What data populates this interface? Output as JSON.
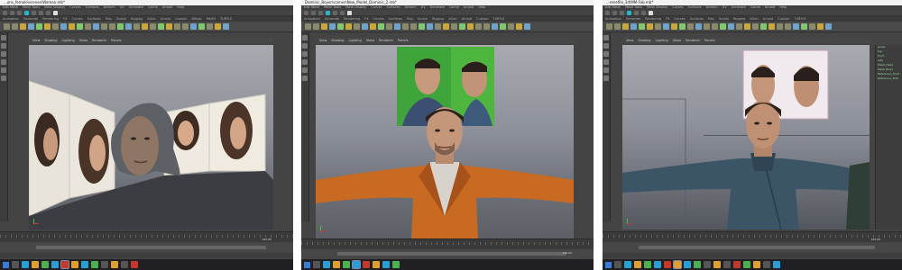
{
  "panels": [
    {
      "id": "p1",
      "title": "...ons_female\\scenes\\Woman.mb*",
      "menus": [
        "Edit Mesh",
        "Mesh Tools",
        "Mesh Display",
        "Curves",
        "Surfaces",
        "Deform",
        "UV",
        "Generate",
        "Cache",
        "Arnold",
        "Help"
      ],
      "shelf_tabs": [
        "Animation",
        "Generate",
        "Rendering",
        "FX",
        "Curves",
        "Surfaces",
        "Poly",
        "Sculpt",
        "Rigging",
        "XGen",
        "Arnold",
        "Custom",
        "Bifrost",
        "MASH",
        "TURTLE"
      ],
      "panel_menu": [
        "View",
        "Shading",
        "Lighting",
        "Show",
        "Renderer",
        "Panels"
      ],
      "range_end": "120.00",
      "frame": "1"
    },
    {
      "id": "p2",
      "title": "Dominic_Boyer\\scenes\\New_Model_Dominic_2.mb*",
      "menus": [
        "Edit Mesh",
        "Mesh Tools",
        "Mesh Display",
        "Curves",
        "Surfaces",
        "Deform",
        "UV",
        "Generate",
        "Cache",
        "Arnold",
        "Help"
      ],
      "shelf_tabs": [
        "Animation",
        "Generate",
        "Rendering",
        "FX",
        "Curves",
        "Surfaces",
        "Poly",
        "Sculpt",
        "Rigging",
        "XGen",
        "Arnold",
        "Custom",
        "TURTLE"
      ],
      "panel_menu": [
        "View",
        "Shading",
        "Lighting",
        "Show",
        "Renderer",
        "Panels"
      ],
      "range_end": "120.00",
      "frame": "1"
    },
    {
      "id": "p3",
      "title": "...renefile_3d\\MM-Fab.mb*",
      "menus": [
        "Edit Mesh",
        "Mesh Tools",
        "Mesh Display",
        "Curves",
        "Surfaces",
        "Deform",
        "UV",
        "Generate",
        "Cache",
        "Arnold",
        "Help"
      ],
      "shelf_tabs": [
        "Animation",
        "Generate",
        "Rendering",
        "FX",
        "Curves",
        "Surfaces",
        "Poly",
        "Sculpt",
        "Rigging",
        "XGen",
        "Arnold",
        "Custom",
        "TURTLE"
      ],
      "panel_menu": [
        "View",
        "Shading",
        "Lighting",
        "Show",
        "Renderer",
        "Panels"
      ],
      "outliner": [
        "persp",
        "top",
        "front",
        "side",
        "Mesh_Head",
        "Mesh_Body",
        "Reference_Front",
        "Reference_Side"
      ],
      "range_end": "120.00",
      "frame": "1"
    }
  ],
  "colors": {
    "maya_bg": "#444444",
    "viewport_top": "#a8aab0",
    "viewport_bottom": "#54575e",
    "green_screen": "#3fa53a",
    "orange_jacket": "#c86a22",
    "blue_suit": "#3c5566",
    "taskbar": "#1f1f24"
  }
}
